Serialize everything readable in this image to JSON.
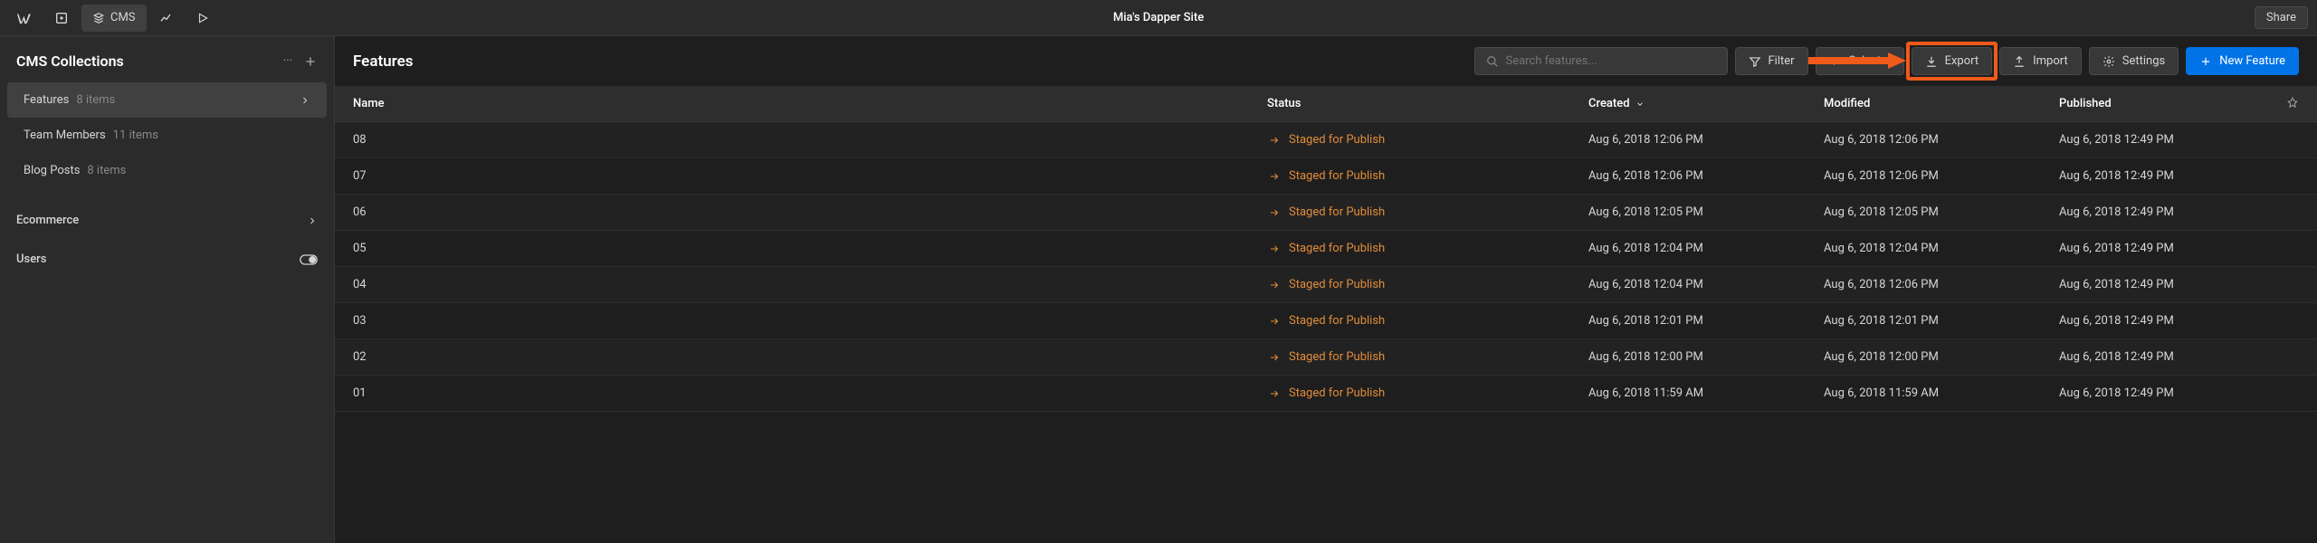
{
  "topbar": {
    "cms_label": "CMS",
    "site_title": "Mia's Dapper Site",
    "share_label": "Share"
  },
  "sidebar": {
    "title": "CMS Collections",
    "collections": [
      {
        "name": "Features",
        "count": "8 items",
        "active": true
      },
      {
        "name": "Team Members",
        "count": "11 items",
        "active": false
      },
      {
        "name": "Blog Posts",
        "count": "8 items",
        "active": false
      }
    ],
    "sections": [
      {
        "name": "Ecommerce"
      },
      {
        "name": "Users"
      }
    ]
  },
  "content": {
    "title": "Features",
    "search_placeholder": "Search features...",
    "buttons": {
      "filter": "Filter",
      "select": "Select...",
      "export": "Export",
      "import": "Import",
      "settings": "Settings",
      "new": "New Feature"
    },
    "columns": {
      "name": "Name",
      "status": "Status",
      "created": "Created",
      "modified": "Modified",
      "published": "Published"
    },
    "rows": [
      {
        "name": "08",
        "status": "Staged for Publish",
        "created": "Aug 6, 2018 12:06 PM",
        "modified": "Aug 6, 2018 12:06 PM",
        "published": "Aug 6, 2018 12:49 PM"
      },
      {
        "name": "07",
        "status": "Staged for Publish",
        "created": "Aug 6, 2018 12:06 PM",
        "modified": "Aug 6, 2018 12:06 PM",
        "published": "Aug 6, 2018 12:49 PM"
      },
      {
        "name": "06",
        "status": "Staged for Publish",
        "created": "Aug 6, 2018 12:05 PM",
        "modified": "Aug 6, 2018 12:05 PM",
        "published": "Aug 6, 2018 12:49 PM"
      },
      {
        "name": "05",
        "status": "Staged for Publish",
        "created": "Aug 6, 2018 12:04 PM",
        "modified": "Aug 6, 2018 12:04 PM",
        "published": "Aug 6, 2018 12:49 PM"
      },
      {
        "name": "04",
        "status": "Staged for Publish",
        "created": "Aug 6, 2018 12:04 PM",
        "modified": "Aug 6, 2018 12:06 PM",
        "published": "Aug 6, 2018 12:49 PM"
      },
      {
        "name": "03",
        "status": "Staged for Publish",
        "created": "Aug 6, 2018 12:01 PM",
        "modified": "Aug 6, 2018 12:01 PM",
        "published": "Aug 6, 2018 12:49 PM"
      },
      {
        "name": "02",
        "status": "Staged for Publish",
        "created": "Aug 6, 2018 12:00 PM",
        "modified": "Aug 6, 2018 12:00 PM",
        "published": "Aug 6, 2018 12:49 PM"
      },
      {
        "name": "01",
        "status": "Staged for Publish",
        "created": "Aug 6, 2018 11:59 AM",
        "modified": "Aug 6, 2018 11:59 AM",
        "published": "Aug 6, 2018 12:49 PM"
      }
    ]
  },
  "highlight": {
    "export": true
  }
}
